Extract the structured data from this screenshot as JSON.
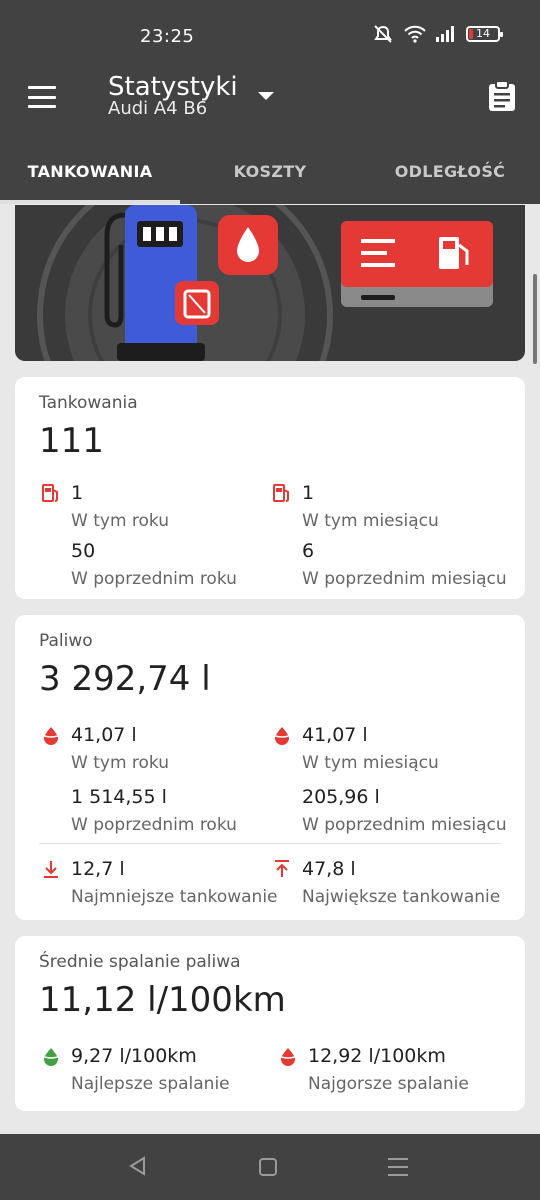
{
  "status_bar": {
    "time": "23:25",
    "battery": "14"
  },
  "app_bar": {
    "title": "Statystyki",
    "subtitle": "Audi A4 B6"
  },
  "tabs": [
    {
      "label": "TANKOWANIA",
      "active": true
    },
    {
      "label": "KOSZTY",
      "active": false
    },
    {
      "label": "ODLEGŁOŚĆ",
      "active": false
    }
  ],
  "refuels_card": {
    "label": "Tankowania",
    "value": "111",
    "stats": [
      {
        "value": "1",
        "label": "W tym roku",
        "icon": "fuel-pump-icon"
      },
      {
        "value": "1",
        "label": "W tym miesiącu",
        "icon": "fuel-pump-icon"
      },
      {
        "value": "50",
        "label": "W poprzednim roku"
      },
      {
        "value": "6",
        "label": "W poprzednim miesiącu"
      }
    ]
  },
  "fuel_card": {
    "label": "Paliwo",
    "value": "3 292,74 l",
    "stats": [
      {
        "value": "41,07 l",
        "label": "W tym roku",
        "icon": "fuel-drop-icon"
      },
      {
        "value": "41,07 l",
        "label": "W tym miesiącu",
        "icon": "fuel-drop-icon"
      },
      {
        "value": "1 514,55 l",
        "label": "W poprzednim roku"
      },
      {
        "value": "205,96 l",
        "label": "W poprzednim miesiącu"
      },
      {
        "value": "12,7 l",
        "label": "Najmniejsze tankowanie",
        "icon": "arrow-down-to-line-icon"
      },
      {
        "value": "47,8 l",
        "label": "Największe tankowanie",
        "icon": "arrow-up-to-line-icon"
      }
    ]
  },
  "consumption_card": {
    "label": "Średnie spalanie paliwa",
    "value": "11,12 l/100km",
    "stats": [
      {
        "value": "9,27 l/100km",
        "label": "Najlepsze spalanie",
        "icon": "fuel-drop-green-icon"
      },
      {
        "value": "12,92 l/100km",
        "label": "Najgorsze spalanie",
        "icon": "fuel-drop-red-icon"
      }
    ]
  },
  "colors": {
    "bar": "#424242",
    "accent_red": "#e53935",
    "good_green": "#43a047",
    "pump_blue": "#3f5bd8"
  }
}
